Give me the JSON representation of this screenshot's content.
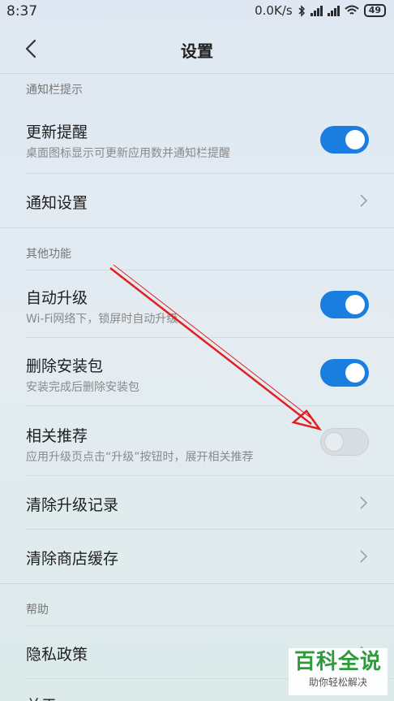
{
  "status_bar": {
    "time": "8:37",
    "net_speed": "0.0K/s",
    "battery": "49"
  },
  "header": {
    "title": "设置"
  },
  "sections": [
    {
      "label": "通知栏提示",
      "rows": [
        {
          "title": "更新提醒",
          "subtitle": "桌面图标显示可更新应用数并通知栏提醒",
          "control": "toggle",
          "on": true
        },
        {
          "title": "通知设置",
          "control": "chevron"
        }
      ]
    },
    {
      "label": "其他功能",
      "rows": [
        {
          "title": "自动升级",
          "subtitle": "Wi-Fi网络下，锁屏时自动升级",
          "control": "toggle",
          "on": true
        },
        {
          "title": "删除安装包",
          "subtitle": "安装完成后删除安装包",
          "control": "toggle",
          "on": true
        },
        {
          "title": "相关推荐",
          "subtitle": "应用升级页点击“升级”按钮时，展开相关推荐",
          "control": "toggle",
          "on": false
        },
        {
          "title": "清除升级记录",
          "control": "chevron"
        },
        {
          "title": "清除商店缓存",
          "control": "chevron"
        }
      ]
    },
    {
      "label": "帮助",
      "rows": [
        {
          "title": "隐私政策",
          "control": "chevron"
        },
        {
          "title": "关于",
          "control": "chevron"
        }
      ]
    }
  ],
  "watermark": {
    "brand": "百科全说",
    "slogan": "助你轻松解决"
  },
  "colors": {
    "accent": "#1a7ee0",
    "annotation": "#e02020",
    "watermark": "#2f9a3c"
  }
}
